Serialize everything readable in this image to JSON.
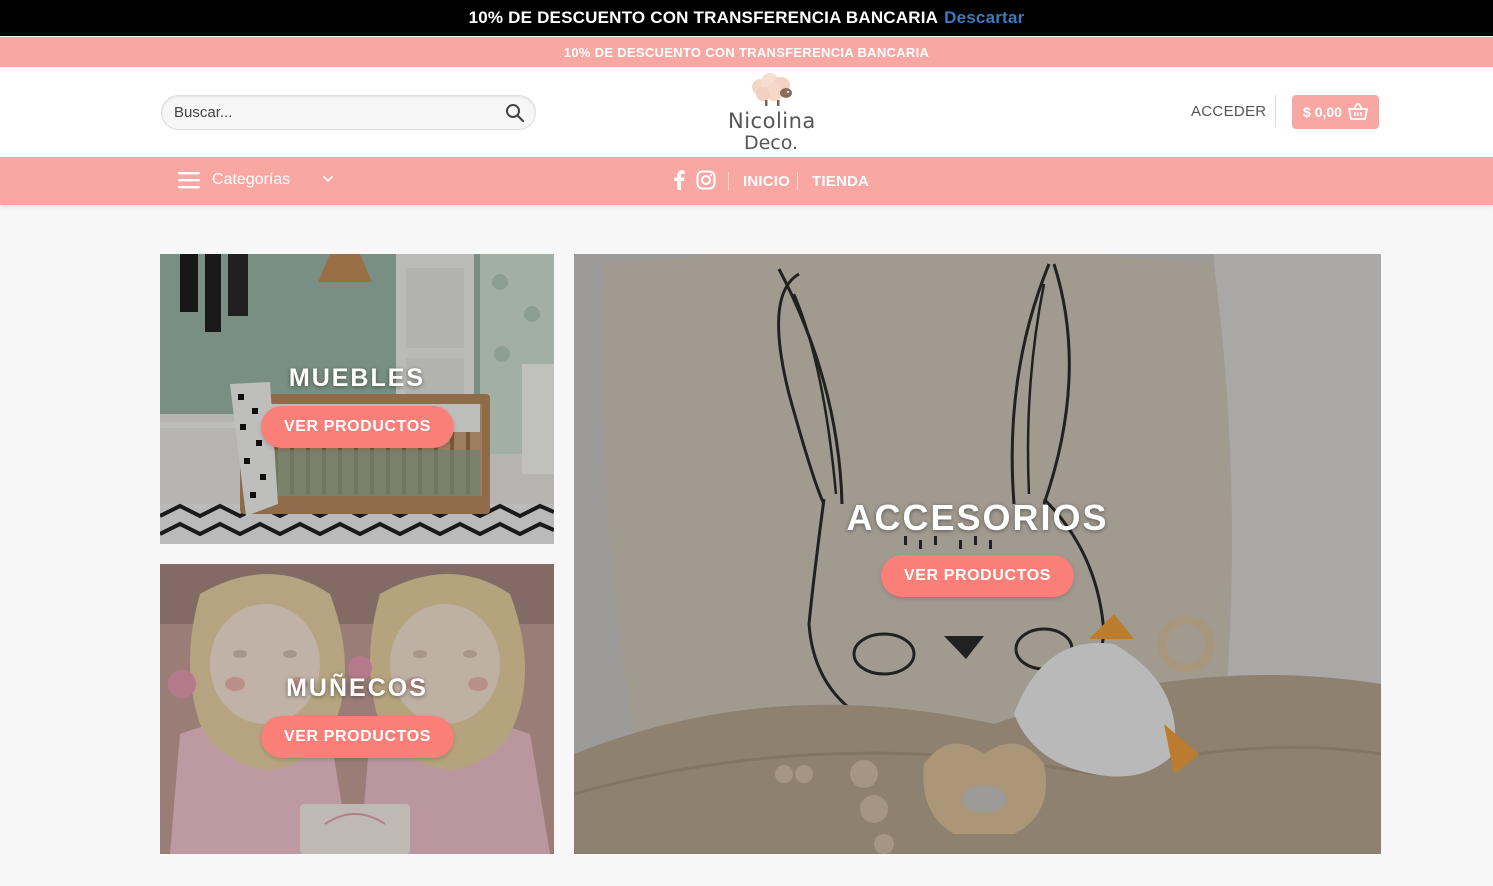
{
  "announcement": {
    "text": "10% DE DESCUENTO CON TRANSFERENCIA BANCARIA",
    "dismiss": "Descartar"
  },
  "promo_bar": {
    "text": "10% DE DESCUENTO CON TRANSFERENCIA BANCARIA"
  },
  "header": {
    "search_placeholder": "Buscar...",
    "logo_line1": "Nicolina",
    "logo_line2": "Deco.",
    "login": "ACCEDER",
    "cart_total": "$ 0,00"
  },
  "nav": {
    "categories_label": "Categorías",
    "links": [
      "INICIO",
      "TIENDA"
    ]
  },
  "tiles": [
    {
      "title": "MUEBLES",
      "button": "VER PRODUCTOS"
    },
    {
      "title": "MUÑECOS",
      "button": "VER PRODUCTOS"
    },
    {
      "title": "ACCESORIOS",
      "button": "VER PRODUCTOS"
    }
  ],
  "colors": {
    "brand_pink": "#f9a7a2",
    "button_coral": "#f97f78",
    "dismiss_link": "#3c7ac0"
  }
}
